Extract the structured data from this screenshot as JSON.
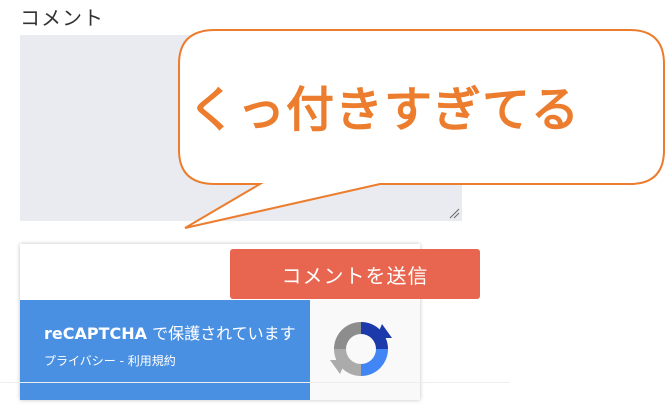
{
  "form": {
    "comment_label": "コメント",
    "submit_label": "コメントを送信"
  },
  "recaptcha": {
    "brand": "reCAPTCHA",
    "protected_text": " で保護されています",
    "privacy_label": "プライバシー",
    "separator": " - ",
    "terms_label": "利用規約"
  },
  "annotation": {
    "callout_text": "くっ付きすぎてる",
    "callout_color": "#ec7d2e"
  },
  "colors": {
    "submit_bg": "#e8664f",
    "recaptcha_blue": "#4a90e2"
  }
}
